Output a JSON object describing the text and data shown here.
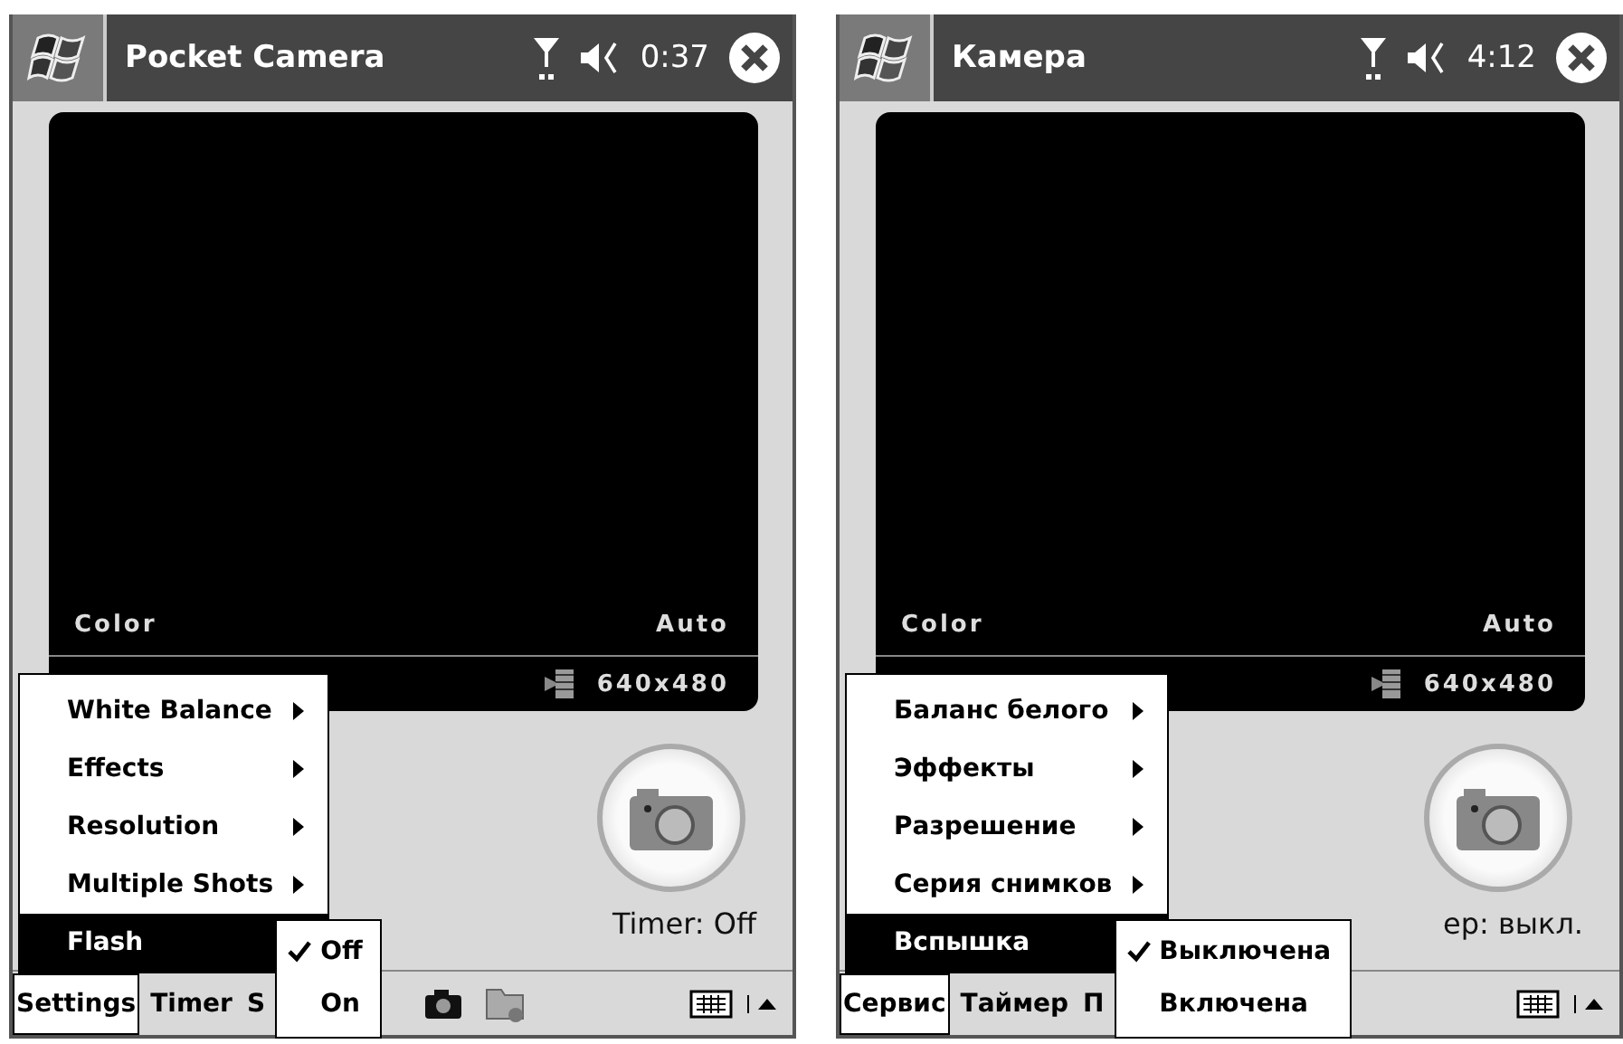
{
  "screens": [
    {
      "title": "Pocket Camera",
      "time": "0:37",
      "viewfinder": {
        "mode": "Color",
        "white_balance": "Auto",
        "resolution": "640x480"
      },
      "timer_label": "Timer: Off",
      "menu": [
        {
          "label": "White Balance",
          "selected": false
        },
        {
          "label": "Effects",
          "selected": false
        },
        {
          "label": "Resolution",
          "selected": false
        },
        {
          "label": "Multiple Shots",
          "selected": false
        },
        {
          "label": "Flash",
          "selected": true
        }
      ],
      "submenu": [
        {
          "label": "Off",
          "checked": true
        },
        {
          "label": "On",
          "checked": false
        }
      ],
      "menubar": [
        {
          "label": "Settings",
          "selected": true
        },
        {
          "label": "Timer",
          "selected": false
        },
        {
          "label": "S",
          "selected": false
        }
      ],
      "toolbar_icons": [
        {
          "kind": "camera"
        },
        {
          "kind": "folder"
        }
      ]
    },
    {
      "title": "Камера",
      "time": "4:12",
      "viewfinder": {
        "mode": "Color",
        "white_balance": "Auto",
        "resolution": "640x480"
      },
      "timer_label": "ер: выкл.",
      "menu": [
        {
          "label": "Баланс белого",
          "selected": false
        },
        {
          "label": "Эффекты",
          "selected": false
        },
        {
          "label": "Разрешение",
          "selected": false
        },
        {
          "label": "Серия снимков",
          "selected": false
        },
        {
          "label": "Вспышка",
          "selected": true
        }
      ],
      "submenu": [
        {
          "label": "Выключена",
          "checked": true
        },
        {
          "label": "Включена",
          "checked": false
        }
      ],
      "menubar": [
        {
          "label": "Сервис",
          "selected": true
        },
        {
          "label": "Таймер",
          "selected": false
        },
        {
          "label": "П",
          "selected": false
        }
      ]
    }
  ]
}
